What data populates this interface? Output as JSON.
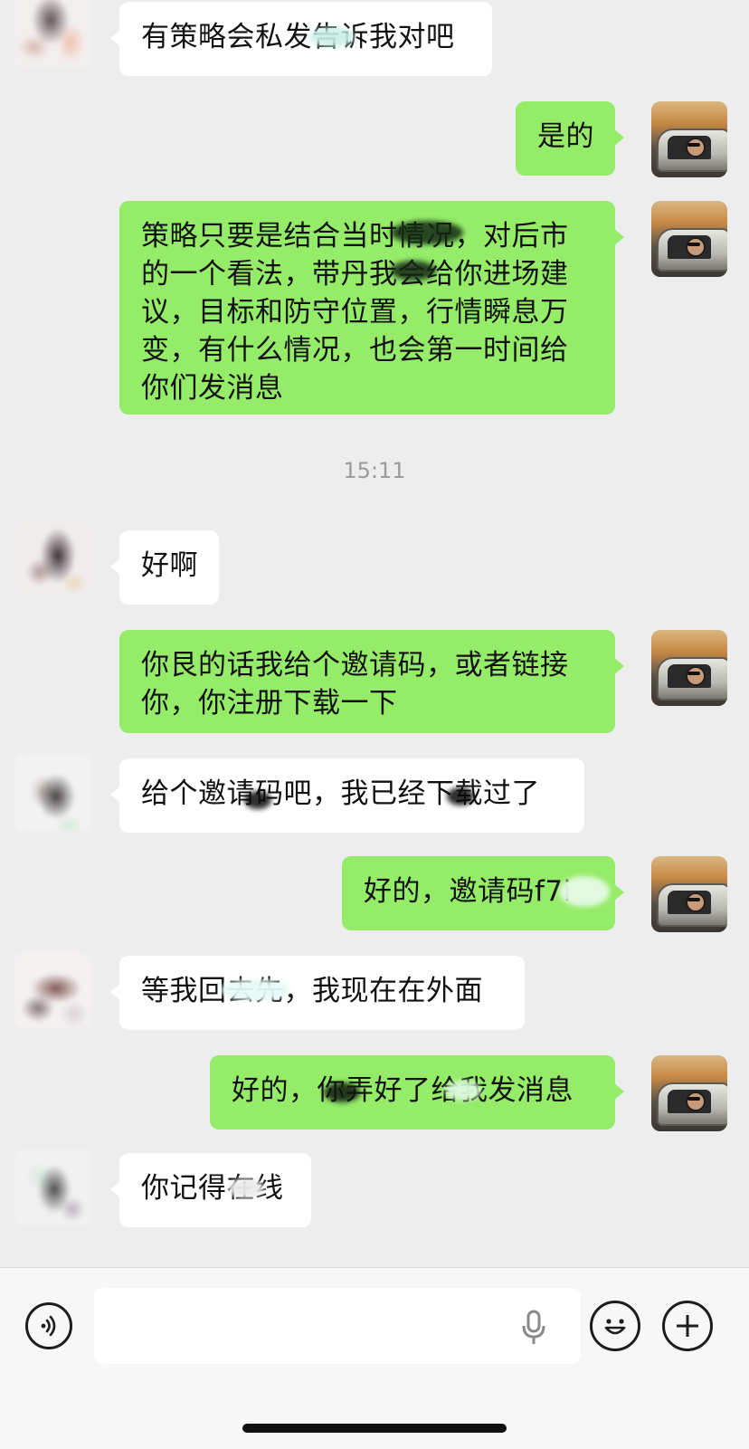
{
  "messages": [
    {
      "side": "in",
      "lines": [
        "有策略会私发告诉我对吧"
      ]
    },
    {
      "side": "out",
      "lines": [
        "是的"
      ]
    },
    {
      "side": "out",
      "lines": [
        "策略只要是结合当时情况，对后市",
        "的一个看法，带丹我会给你进场建",
        "议，目标和防守位置，行情瞬息万",
        "变，有什么情况，也会第一时间给",
        "你们发消息"
      ]
    },
    {
      "side": "in",
      "lines": [
        "好啊"
      ]
    },
    {
      "side": "out",
      "lines": [
        "你艮的话我给个邀请码，或者链接",
        "你，你注册下载一下"
      ]
    },
    {
      "side": "in",
      "lines": [
        "给个邀请码吧，我已经下载过了"
      ]
    },
    {
      "side": "out",
      "lines": [
        "好的，邀请码f7i"
      ]
    },
    {
      "side": "in",
      "lines": [
        "等我回去先，我现在在外面"
      ]
    },
    {
      "side": "out",
      "lines": [
        "好的，你弄好了给我发消息"
      ]
    },
    {
      "side": "in",
      "lines": [
        "你记得在线"
      ]
    }
  ],
  "timestamp": "15:11",
  "input_bar": {
    "voice_icon": "voice-icon",
    "mic_icon": "microphone-icon",
    "emoji_icon": "emoji-icon",
    "plus_icon": "plus-icon",
    "input_value": ""
  },
  "colors": {
    "background": "#ededed",
    "bubble_in": "#ffffff",
    "bubble_out": "#95ec69",
    "timestamp_text": "#9b9b9b"
  }
}
